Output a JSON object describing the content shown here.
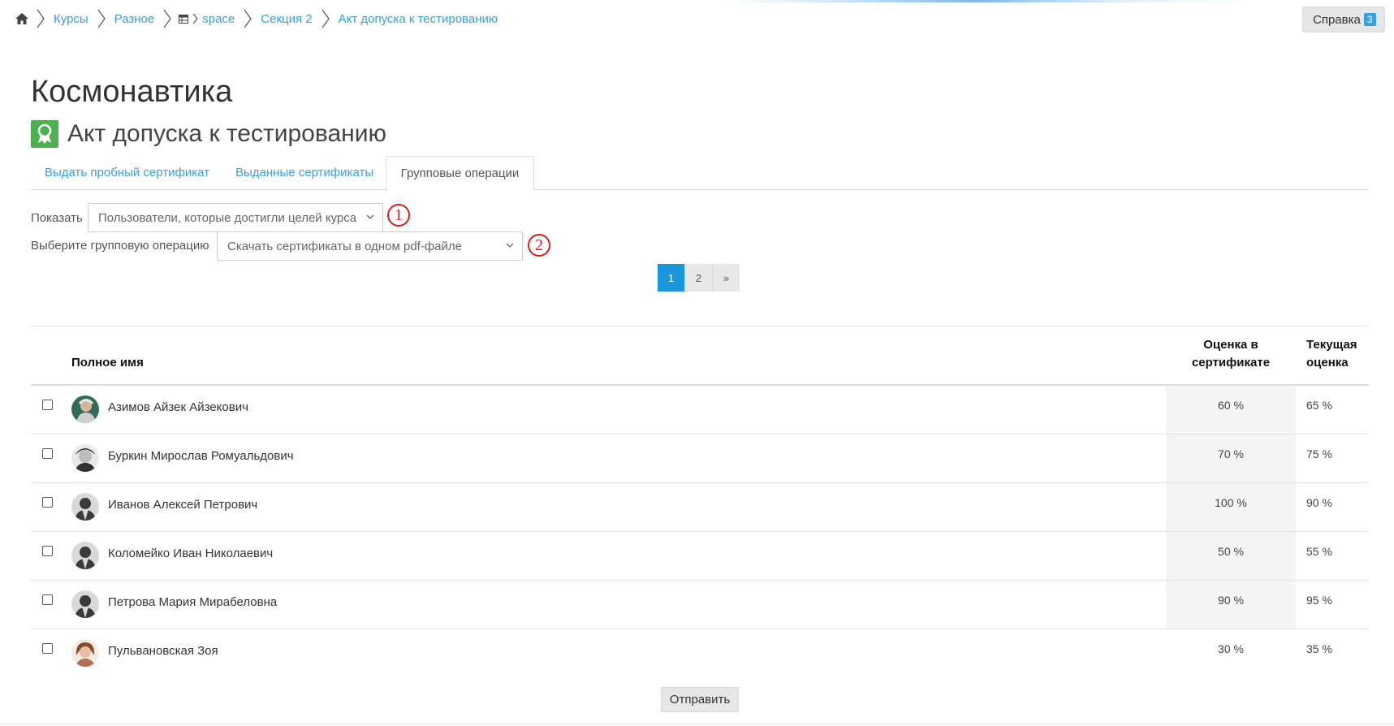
{
  "breadcrumb": {
    "items": [
      {
        "label": "Курсы"
      },
      {
        "label": "Разное"
      },
      {
        "label": "space",
        "icon": "table-icon"
      },
      {
        "label": "Секция 2"
      },
      {
        "label": "Акт допуска к тестированию"
      }
    ]
  },
  "help": {
    "label": "Справка",
    "badge": "3"
  },
  "course_title": "Космонавтика",
  "page_title": "Акт допуска к тестированию",
  "tabs": [
    {
      "label": "Выдать пробный сертификат"
    },
    {
      "label": "Выданные сертификаты"
    },
    {
      "label": "Групповые операции",
      "active": true
    }
  ],
  "filters": {
    "show_label": "Показать",
    "show_value": "Пользователи, которые достигли целей курса",
    "op_label": "Выберите групповую операцию",
    "op_value": "Скачать сертификаты в одном pdf-файле",
    "marker1": "1",
    "marker2": "2"
  },
  "pagination": {
    "pages": [
      "1",
      "2",
      "»"
    ],
    "active": "1"
  },
  "table": {
    "headers": {
      "fullname": "Полное имя",
      "cert_grade_1": "Оценка в",
      "cert_grade_2": "сертификате",
      "current_grade_1": "Текущая",
      "current_grade_2": "оценка"
    },
    "rows": [
      {
        "name": "Азимов Айзек Айзекович",
        "cert_grade": "60 %",
        "current_grade": "65 %",
        "avatar": "photo-avatar"
      },
      {
        "name": "Буркин Мирослав Ромуальдович",
        "cert_grade": "70 %",
        "current_grade": "75 %",
        "avatar": "photo-avatar"
      },
      {
        "name": "Иванов Алексей Петрович",
        "cert_grade": "100 %",
        "current_grade": "90 %",
        "avatar": "default-avatar"
      },
      {
        "name": "Коломейко Иван Николаевич",
        "cert_grade": "50 %",
        "current_grade": "55 %",
        "avatar": "default-avatar"
      },
      {
        "name": "Петрова Мария Мирабеловна",
        "cert_grade": "90 %",
        "current_grade": "95 %",
        "avatar": "default-avatar"
      },
      {
        "name": "Пульвановская Зоя",
        "cert_grade": "30 %",
        "current_grade": "35 %",
        "avatar": "photo-avatar"
      }
    ]
  },
  "submit_label": "Отправить",
  "colors": {
    "link": "#3aa0d8",
    "active_page": "#1a96dc",
    "module_icon": "#4caf50",
    "marker": "#e01b1b"
  }
}
